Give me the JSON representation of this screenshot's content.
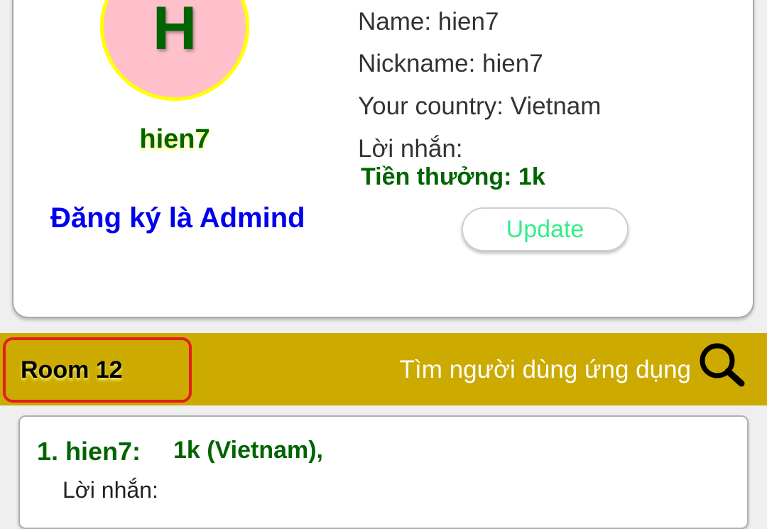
{
  "profile": {
    "avatar_letter": "H",
    "username": "hien7",
    "register_admin_link": "Đăng ký là Admind",
    "name_line": "Name: hien7",
    "nickname_line": "Nickname: hien7",
    "country_line": "Your country: Vietnam",
    "message_line": "Lời nhắn:",
    "reward_line": "Tiền thưởng: 1k",
    "update_button": "Update"
  },
  "room_bar": {
    "room_label": "Room 12",
    "search_label": "Tìm người dùng ứng dụng",
    "search_icon": "search-icon"
  },
  "users": [
    {
      "rank_name": "1. hien7:",
      "detail": "1k (Vietnam),",
      "message": "Lời nhắn:"
    }
  ],
  "colors": {
    "avatar_bg": "#ffc0cb",
    "avatar_border": "#ffff00",
    "primary_green": "#006400",
    "link_blue": "#0000ee",
    "bar_gold": "#ccaa00",
    "highlight_red": "#e02020",
    "update_text": "#33ee88"
  }
}
